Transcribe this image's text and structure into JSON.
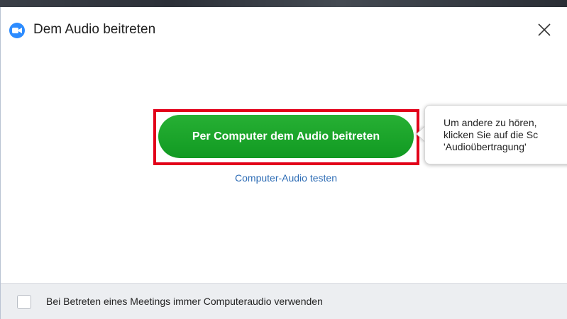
{
  "window": {
    "title": "Dem Audio beitreten",
    "app_icon": "zoom-camera-icon",
    "close_icon": "close-icon"
  },
  "main": {
    "join_button_label": "Per Computer dem Audio beitreten",
    "test_link_label": "Computer-Audio testen"
  },
  "tooltip": {
    "lines": [
      "Um andere zu hören,",
      "klicken Sie auf die Sc",
      "'Audioübertragung'"
    ]
  },
  "footer": {
    "checkbox_label": "Bei Betreten eines Meetings immer Computeraudio verwenden",
    "checked": false
  },
  "colors": {
    "accent_blue": "#2d8cff",
    "button_green": "#1aa52c",
    "highlight_red": "#e2001a",
    "link_blue": "#2d6cb5"
  }
}
